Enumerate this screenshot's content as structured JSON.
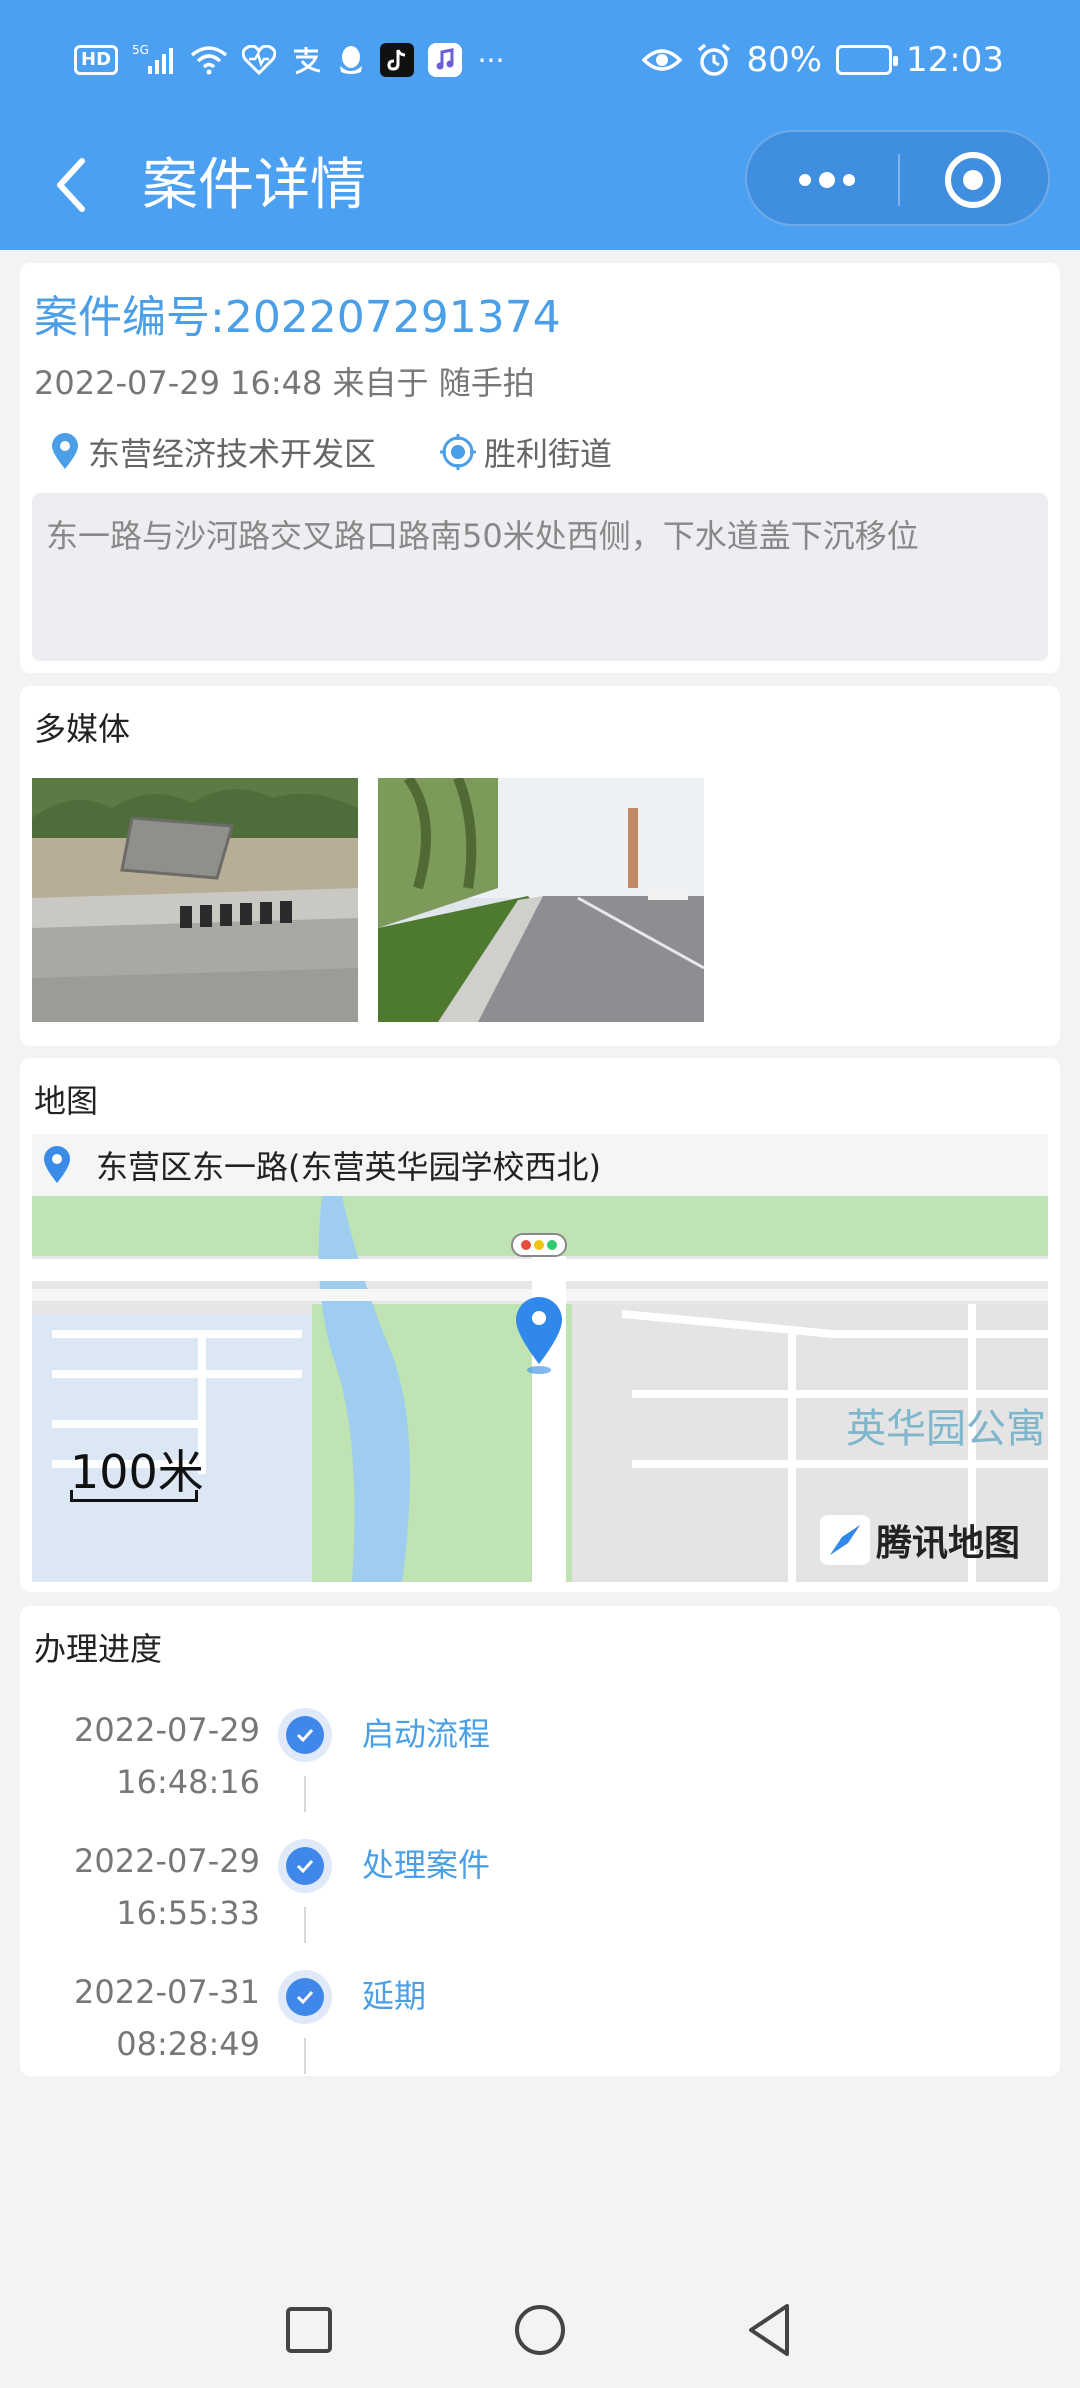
{
  "status_bar": {
    "left_icons": [
      "hd-icon",
      "5g-signal-icon",
      "wifi-icon",
      "health-icon",
      "alipay-icon",
      "qq-icon",
      "tiktok-icon",
      "music-icon",
      "more-notifications-icon"
    ],
    "hd": "HD",
    "net": "5G",
    "more": "···",
    "battery_percent": "80%",
    "battery_level": 0.8,
    "time": "12:03"
  },
  "nav": {
    "title": "案件详情"
  },
  "case": {
    "number": "案件编号:202207291374",
    "meta": "2022-07-29 16:48 来自于 随手拍",
    "district": "东营经济技术开发区",
    "street": "胜利街道",
    "description": "东一路与沙河路交叉路口路南50米处西侧，下水道盖下沉移位"
  },
  "media": {
    "title": "多媒体",
    "photos": [
      "manhole-cover-photo",
      "road-photo"
    ]
  },
  "map": {
    "title": "地图",
    "address": "东营区东一路(东营英华园学校西北)",
    "scale": "100米",
    "area_label": "英华园公寓",
    "provider": "腾讯地图"
  },
  "progress": {
    "title": "办理进度",
    "steps": [
      {
        "date": "2022-07-29",
        "time": "16:48:16",
        "label": "启动流程"
      },
      {
        "date": "2022-07-29",
        "time": "16:55:33",
        "label": "处理案件"
      },
      {
        "date": "2022-07-31",
        "time": "08:28:49",
        "label": "延期"
      }
    ]
  },
  "colors": {
    "header": "#4ca0f1",
    "accent": "#4a9fe6",
    "node": "#3f87e9"
  }
}
